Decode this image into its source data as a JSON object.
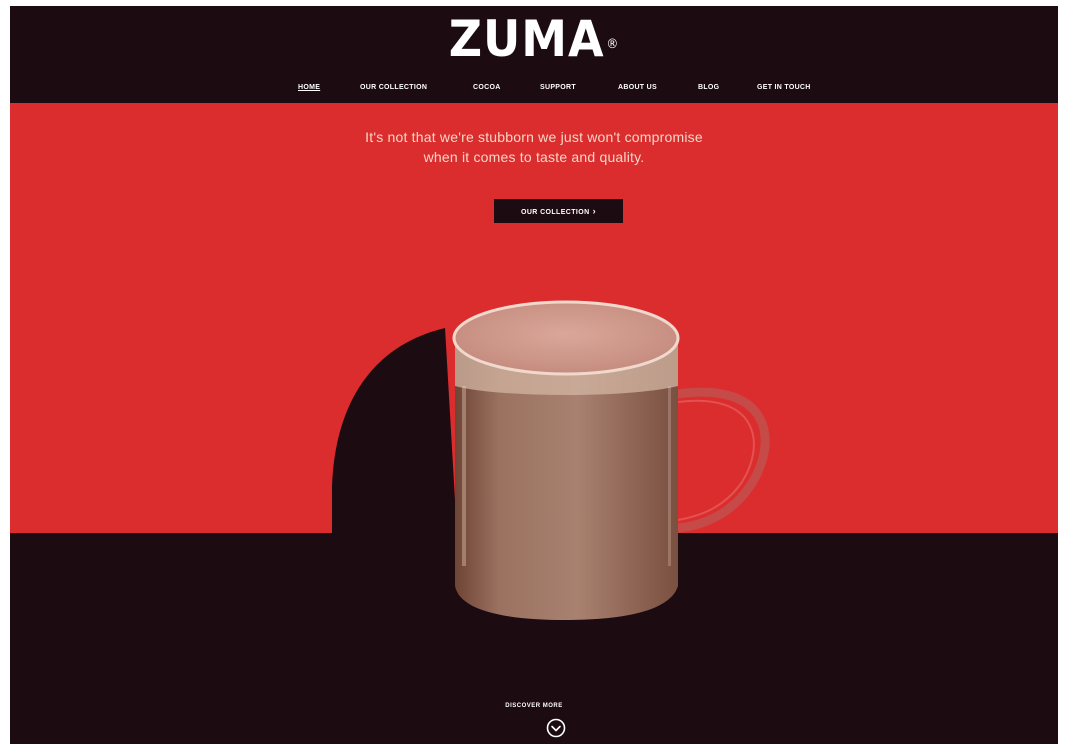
{
  "header": {
    "logo": "ZUMA",
    "logo_mark": "®"
  },
  "nav": {
    "items": [
      {
        "label": "HOME",
        "active": true
      },
      {
        "label": "OUR COLLECTION"
      },
      {
        "label": "COCOA"
      },
      {
        "label": "SUPPORT"
      },
      {
        "label": "ABOUT US"
      },
      {
        "label": "BLOG"
      },
      {
        "label": "GET IN TOUCH"
      }
    ]
  },
  "hero": {
    "tagline_line1": "It's not that we're stubborn we just won't compromise",
    "tagline_line2": "when it comes to taste and quality.",
    "cta_label": "OUR COLLECTION",
    "cta_icon": "chevron-right-icon"
  },
  "footer": {
    "discover_label": "DISCOVER MORE",
    "discover_icon": "chevron-down-circle-icon"
  },
  "colors": {
    "dark": "#1c0b10",
    "red": "#db2c2e",
    "cream": "#f4d7c8"
  }
}
